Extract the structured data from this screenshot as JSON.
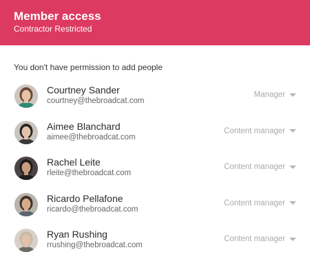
{
  "header": {
    "title": "Member access",
    "subtitle": "Contractor Restricted",
    "background_color": "#dd3a62"
  },
  "notice": "You don't have permission to add people",
  "members": [
    {
      "name": "Courtney Sander",
      "email": "courtney@thebroadcat.com",
      "role": "Manager",
      "avatar": {
        "hair": "#6b4a3a",
        "skin": "#e9c3a6",
        "bg": "#cfc6bf",
        "shirt": "#2f8a73"
      }
    },
    {
      "name": "Aimee Blanchard",
      "email": "aimee@thebroadcat.com",
      "role": "Content manager",
      "avatar": {
        "hair": "#2a2520",
        "skin": "#e2c2ad",
        "bg": "#c9c4bf",
        "shirt": "#3a3a3a"
      }
    },
    {
      "name": "Rachel Leite",
      "email": "rleite@thebroadcat.com",
      "role": "Content manager",
      "avatar": {
        "hair": "#1f1a17",
        "skin": "#c89c80",
        "bg": "#4a4543",
        "shirt": "#1e1e1e"
      }
    },
    {
      "name": "Ricardo Pellafone",
      "email": "ricardo@thebroadcat.com",
      "role": "Content manager",
      "avatar": {
        "hair": "#3d3128",
        "skin": "#d8ab8c",
        "bg": "#b9b3ab",
        "shirt": "#5c6670"
      }
    },
    {
      "name": "Ryan Rushing",
      "email": "rrushing@thebroadcat.com",
      "role": "Content manager",
      "avatar": {
        "hair": "#c8b8a6",
        "skin": "#e3c2aa",
        "bg": "#d6d0c8",
        "shirt": "#6d6a66"
      }
    }
  ]
}
